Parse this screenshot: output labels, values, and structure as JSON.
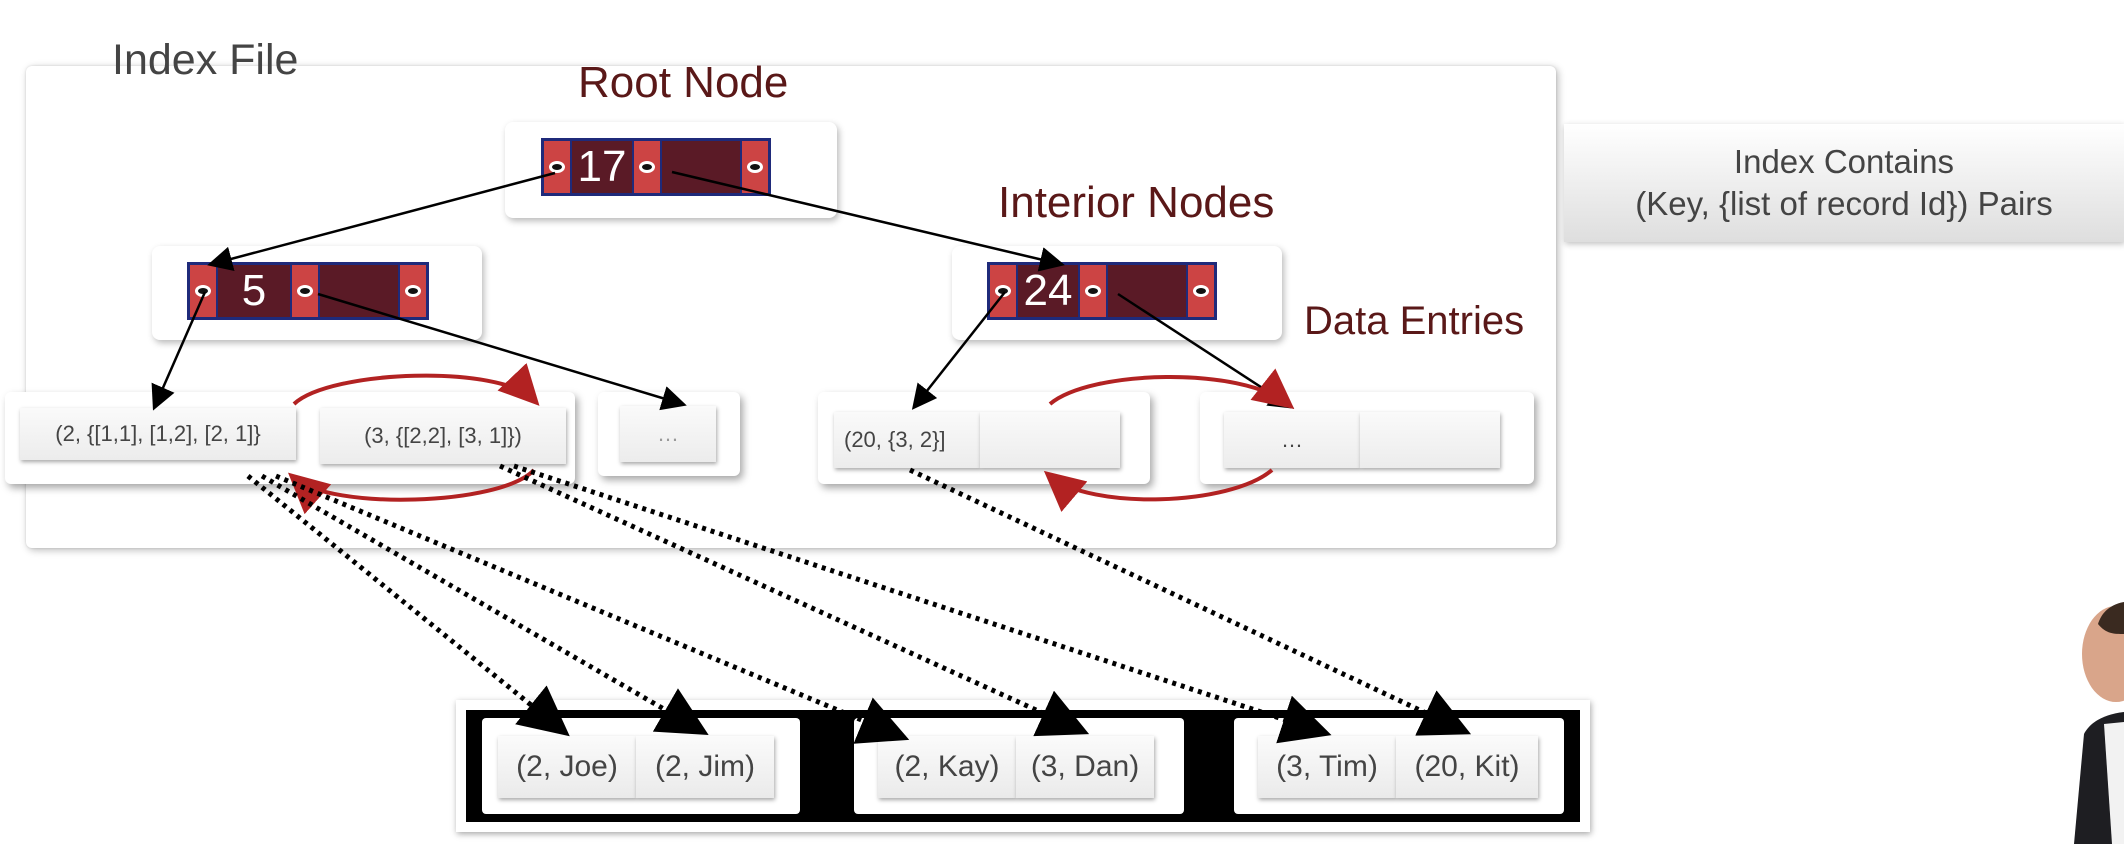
{
  "labels": {
    "index_file": "Index File",
    "root_node": "Root Node",
    "interior_nodes": "Interior Nodes",
    "data_entries": "Data Entries"
  },
  "callout": {
    "line1": "Index Contains",
    "line2": "(Key, {list of record Id}) Pairs"
  },
  "root": {
    "key": "17"
  },
  "interior": {
    "left_key": "5",
    "right_key": "24"
  },
  "leaves": {
    "entry1": "(2, {[1,1], [1,2], [2, 1]}",
    "entry2": "(3, {[2,2], [3, 1]})",
    "entry3": "…",
    "entry4": "(20, {3, 2}]",
    "entry5": "",
    "entry6": "…",
    "entry7": ""
  },
  "records": {
    "r1": "(2, Joe)",
    "r2": "(2, Jim)",
    "r3": "(2, Kay)",
    "r4": "(3, Dan)",
    "r5": "(3, Tim)",
    "r6": "(20, Kit)"
  },
  "colors": {
    "node_fill": "#5a1a26",
    "pointer_fill": "#cc4444",
    "node_border": "#1f2a7a",
    "sibling_arrow": "#b22222",
    "label_maroon": "#5a1818"
  }
}
